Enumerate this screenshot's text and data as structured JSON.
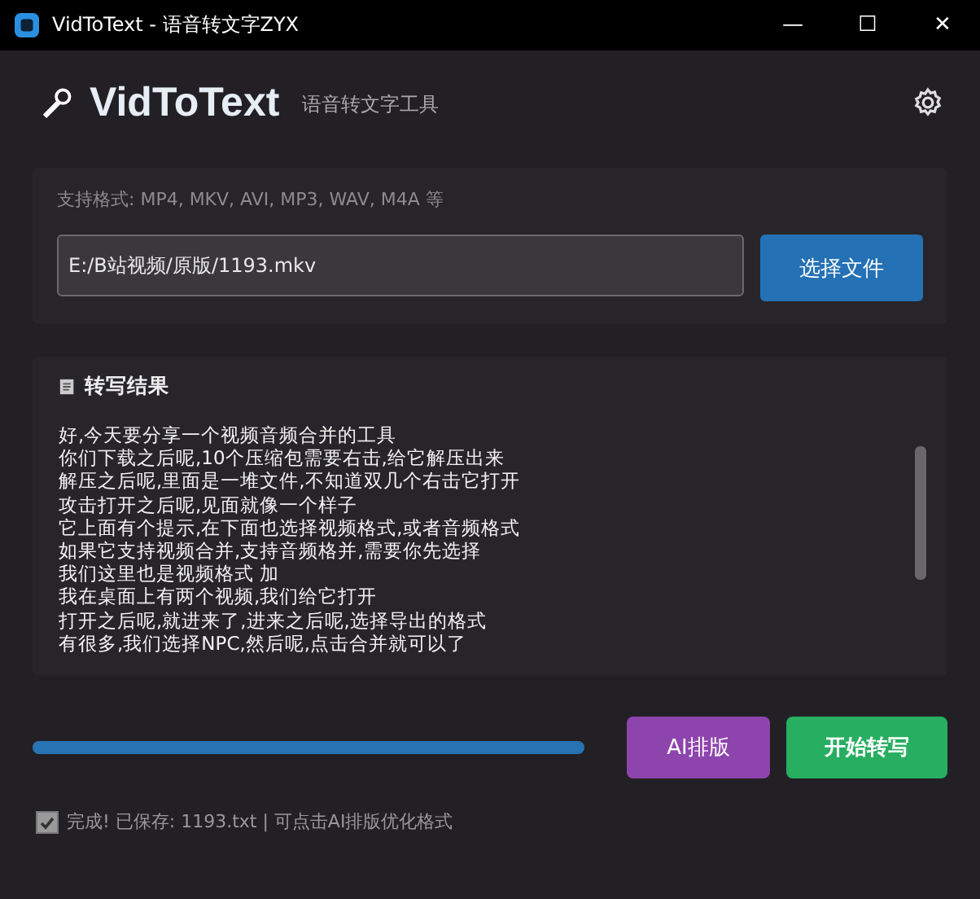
{
  "window": {
    "title": "VidToText - 语音转文字ZYX",
    "controls": [
      "—",
      "☐",
      "✕"
    ]
  },
  "header": {
    "app_name": "VidToText",
    "subtitle": "语音转文字工具"
  },
  "file_panel": {
    "formats": "支持格式: MP4, MKV, AVI, MP3, WAV, M4A 等",
    "path": "E:/B站视频/原版/1193.mkv",
    "button": "选择文件"
  },
  "result_panel": {
    "title": "转写结果",
    "lines": [
      "好,今天要分享一个视频音频合并的工具",
      "你们下载之后呢,10个压缩包需要右击,给它解压出来",
      "解压之后呢,里面是一堆文件,不知道双几个右击它打开",
      "攻击打开之后呢,见面就像一个样子",
      "它上面有个提示,在下面也选择视频格式,或者音频格式",
      "如果它支持视频合并,支持音频格并,需要你先选择",
      "我们这里也是视频格式 加",
      "我在桌面上有两个视频,我们给它打开",
      "打开之后呢,就进来了,进来之后呢,选择导出的格式",
      "有很多,我们选择NPC,然后呢,点击合并就可以了"
    ]
  },
  "progress": {
    "level": 1
  },
  "buttons": [
    {
      "label": "AI排版",
      "kind": "ai"
    },
    {
      "label": "开始转写",
      "kind": "start"
    }
  ],
  "status": {
    "checked": true,
    "text": "完成! 已保存: 1193.txt | 可点击AI排版优化格式"
  }
}
